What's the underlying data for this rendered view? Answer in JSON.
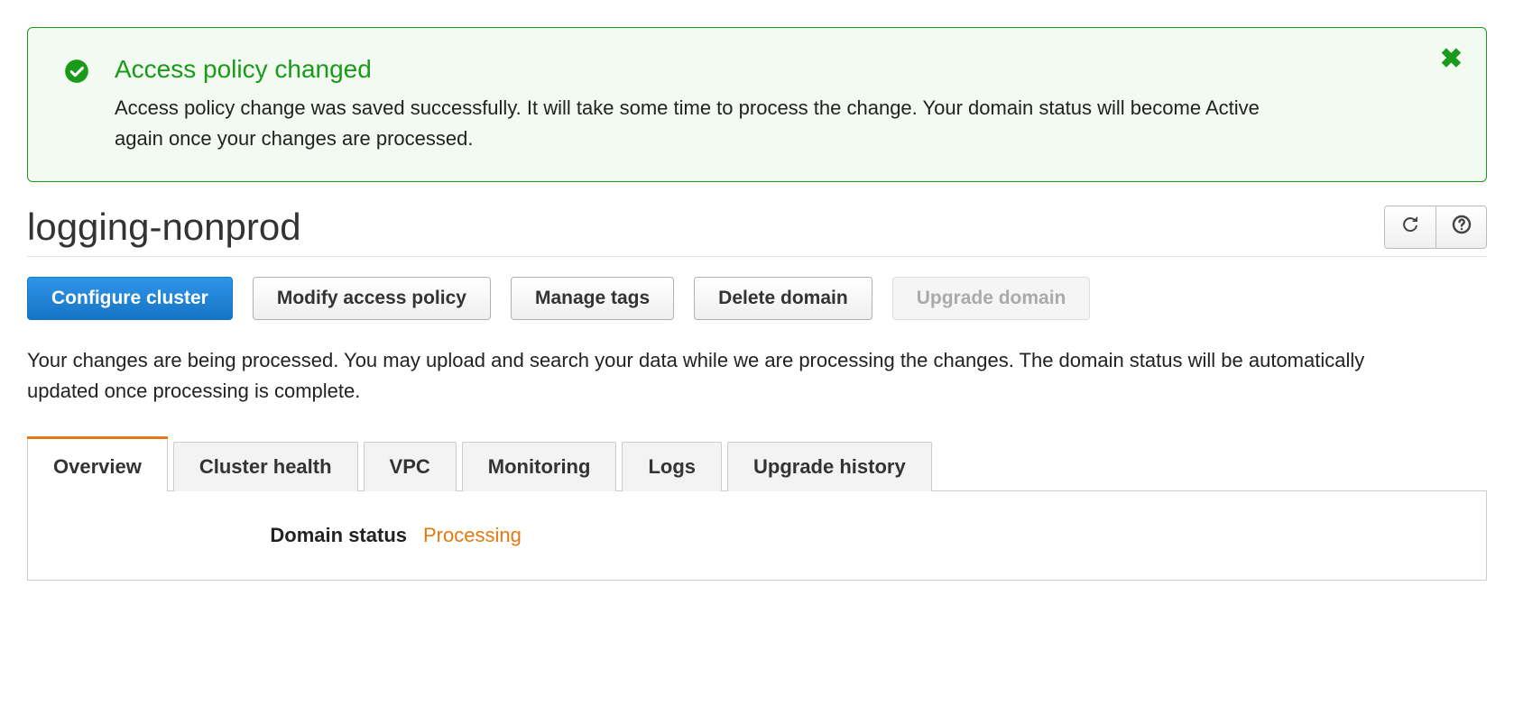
{
  "alert": {
    "title": "Access policy changed",
    "message": "Access policy change was saved successfully. It will take some time to process the change. Your domain status will become Active again once your changes are processed."
  },
  "page": {
    "title": "logging-nonprod"
  },
  "actions": {
    "configure_cluster": "Configure cluster",
    "modify_access_policy": "Modify access policy",
    "manage_tags": "Manage tags",
    "delete_domain": "Delete domain",
    "upgrade_domain": "Upgrade domain"
  },
  "status_text": "Your changes are being processed. You may upload and search your data while we are processing the changes. The domain status will be automatically updated once processing is complete.",
  "tabs": {
    "overview": "Overview",
    "cluster_health": "Cluster health",
    "vpc": "VPC",
    "monitoring": "Monitoring",
    "logs": "Logs",
    "upgrade_history": "Upgrade history"
  },
  "overview": {
    "domain_status_label": "Domain status",
    "domain_status_value": "Processing"
  }
}
